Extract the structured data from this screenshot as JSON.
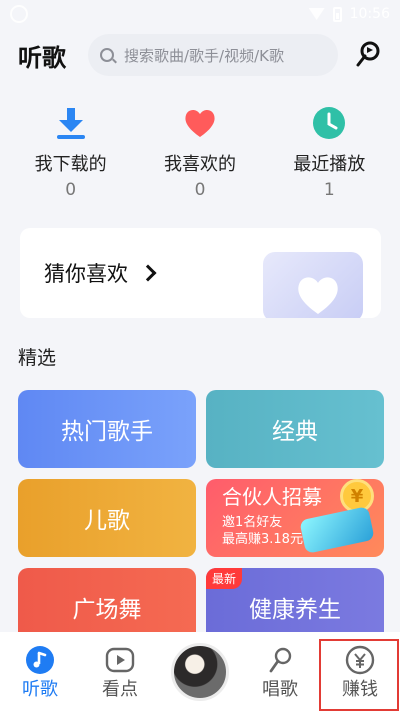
{
  "status_bar": {
    "time": "10:56"
  },
  "header": {
    "title": "听歌",
    "search_placeholder": "搜索歌曲/歌手/视频/K歌"
  },
  "quick_actions": [
    {
      "label": "我下载的",
      "count": "0",
      "icon": "download-icon",
      "color": "#2b86f3"
    },
    {
      "label": "我喜欢的",
      "count": "0",
      "icon": "heart-icon",
      "color": "#ff5b5b"
    },
    {
      "label": "最近播放",
      "count": "1",
      "icon": "clock-icon",
      "color": "#2fc0a7"
    }
  ],
  "guess": {
    "label": "猜你喜欢"
  },
  "section": {
    "title": "精选"
  },
  "tiles": [
    {
      "label": "热门歌手"
    },
    {
      "label": "经典"
    },
    {
      "label": "儿歌"
    },
    {
      "label": "合伙人招募",
      "sub1": "邀1名好友",
      "sub2": "最高赚3.18元",
      "coin": "¥"
    },
    {
      "label": "广场舞"
    },
    {
      "label": "健康养生",
      "badge": "最新"
    }
  ],
  "tabbar": {
    "items": [
      {
        "label": "听歌",
        "icon": "music-note-icon",
        "active": true
      },
      {
        "label": "看点",
        "icon": "play-icon",
        "active": false
      },
      {
        "label": "唱歌",
        "icon": "microphone-icon",
        "active": false
      },
      {
        "label": "赚钱",
        "icon": "yuan-icon",
        "active": false
      }
    ]
  },
  "colors": {
    "accent": "#1f7cf3",
    "highlight_box": "#e23b35",
    "background": "#f4f5f9"
  }
}
